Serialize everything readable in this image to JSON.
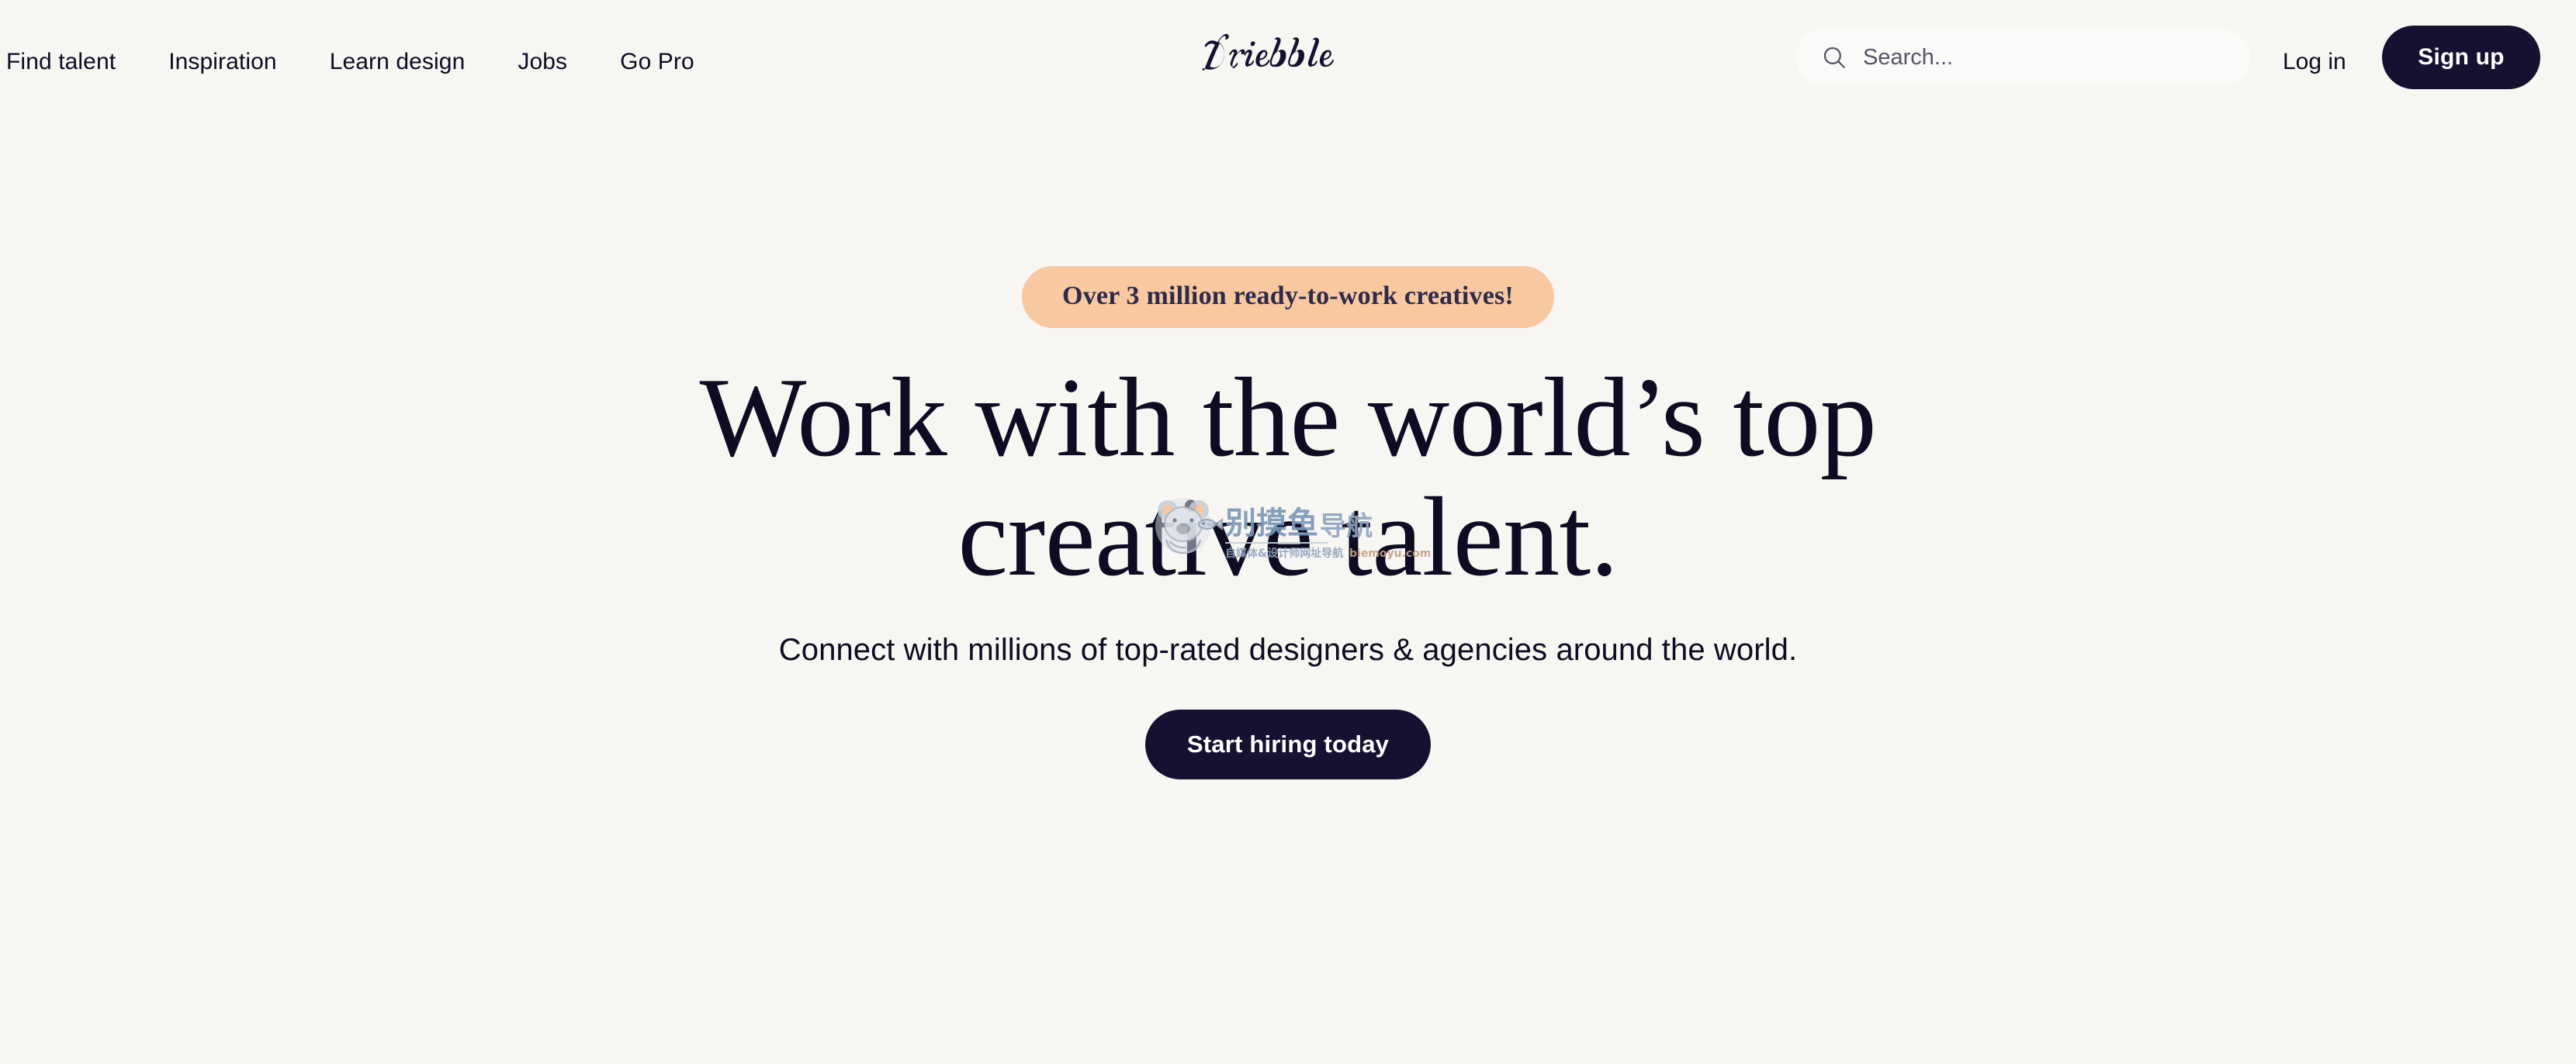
{
  "header": {
    "nav_items": [
      {
        "label": "Find talent",
        "name": "find-talent"
      },
      {
        "label": "Inspiration",
        "name": "inspiration"
      },
      {
        "label": "Learn design",
        "name": "learn-design"
      },
      {
        "label": "Jobs",
        "name": "jobs"
      },
      {
        "label": "Go Pro",
        "name": "go-pro"
      }
    ],
    "logo_text": "Dribbble",
    "search": {
      "placeholder": "Search...",
      "value": "",
      "icon": "search-icon"
    },
    "login_label": "Log in",
    "signup_label": "Sign up"
  },
  "hero": {
    "badge": "Over 3 million ready-to-work creatives!",
    "headline_line1": "Work with the world’s top",
    "headline_line2": "creative talent.",
    "subheadline": "Connect with millions of top-rated designers & agencies around the world.",
    "cta_label": "Start hiring today"
  },
  "watermark": {
    "title": "别摸鱼导航",
    "subtitle": "自媒体&设计师网址导航 biemoyu.com"
  },
  "colors": {
    "page_background": "#F7F6F2",
    "ink": "#0D0C22",
    "button_dark": "#151231",
    "badge_background": "#F8C8A1",
    "badge_text": "#2D2A4A",
    "search_background": "#FBFAF9",
    "placeholder": "#585364",
    "watermark_blue": "#7D98B8"
  }
}
